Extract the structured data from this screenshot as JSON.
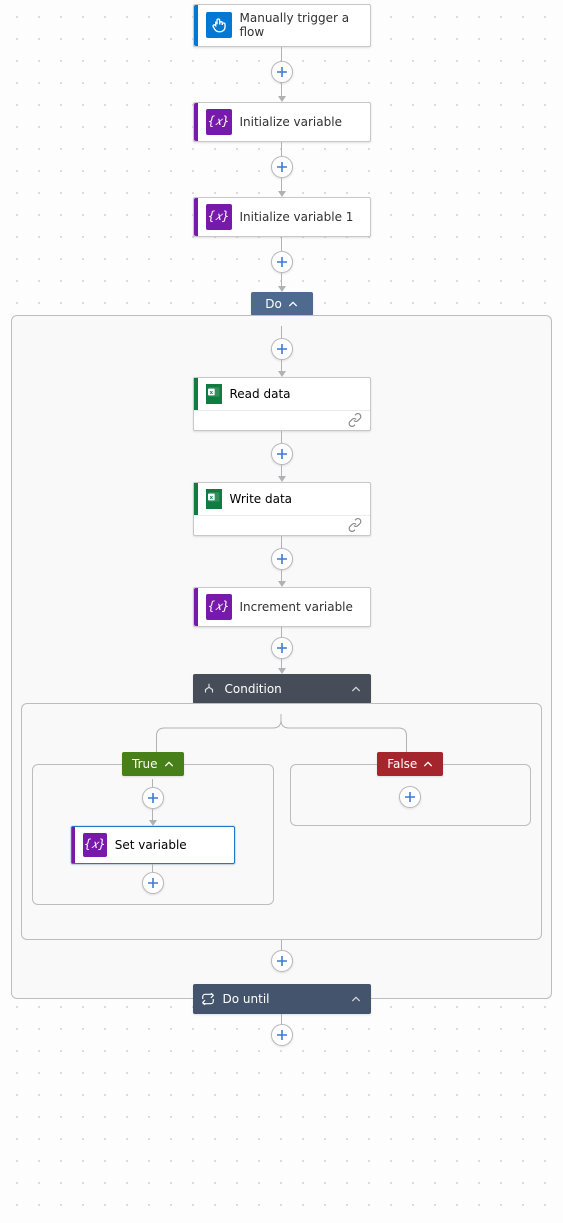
{
  "trigger": {
    "label": "Manually trigger a flow"
  },
  "initVar1": {
    "label": "Initialize variable"
  },
  "initVar2": {
    "label": "Initialize variable 1"
  },
  "doHeader": {
    "label": "Do"
  },
  "readData": {
    "label": "Read data"
  },
  "writeData": {
    "label": "Write data"
  },
  "incrementVar": {
    "label": "Increment variable"
  },
  "condition": {
    "label": "Condition"
  },
  "branchTrue": {
    "label": "True"
  },
  "branchFalse": {
    "label": "False"
  },
  "setVar": {
    "label": "Set variable"
  },
  "doUntil": {
    "label": "Do until"
  },
  "icons": {
    "touch": "touch-icon",
    "variable": "variable-icon",
    "excel": "excel-icon",
    "condition": "condition-icon",
    "loop": "loop-icon",
    "link": "link-icon",
    "chevronUp": "chevron-up-icon",
    "plus": "plus-icon"
  },
  "colors": {
    "blueAccent": "#0078d4",
    "purple": "#7719aa",
    "greenExcel": "#107c41",
    "darkSlate": "#464c58",
    "conditionGreen": "#478019",
    "conditionRed": "#a4262c",
    "doBlue": "#4f6a8f",
    "doUntil": "#44546c"
  }
}
